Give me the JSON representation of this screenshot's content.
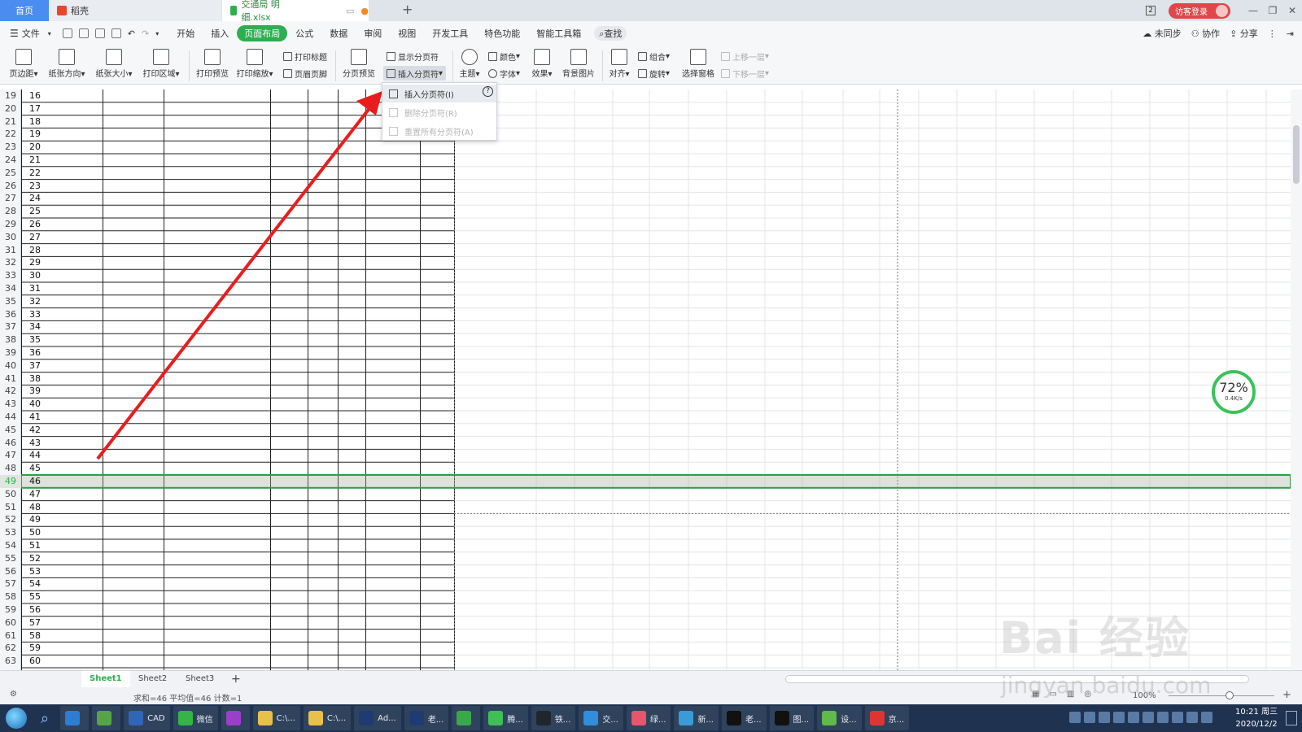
{
  "titlebar": {
    "home_tab": "首页",
    "daoke_tab": "稻壳",
    "file_tab": "交通局 明细.xlsx",
    "new_tab_glyph": "+",
    "badge": "2",
    "login": "访客登录"
  },
  "menubar": {
    "file_label": "文件",
    "tabs": [
      "开始",
      "插入",
      "页面布局",
      "公式",
      "数据",
      "审阅",
      "视图",
      "开发工具",
      "特色功能",
      "智能工具箱"
    ],
    "active_tab": "页面布局",
    "search_label": "查找",
    "right": {
      "sync": "未同步",
      "collab": "协作",
      "share": "分享"
    }
  },
  "ribbon": {
    "margins": "页边距",
    "orientation": "纸张方向",
    "size": "纸张大小",
    "print_area": "打印区域",
    "print_preview": "打印预览",
    "print_scale": "打印缩放",
    "print_titles": "打印标题",
    "header_footer": "页眉页脚",
    "page_break_preview": "分页预览",
    "show_page_breaks": "显示分页符",
    "insert_page_break": "插入分页符",
    "theme": "主题",
    "colors": "颜色",
    "fonts": "字体",
    "effects": "效果",
    "background": "背景图片",
    "align": "对齐",
    "group": "组合",
    "rotate": "旋转",
    "selection_pane": "选择窗格",
    "bring_forward": "上移一层",
    "send_backward": "下移一层"
  },
  "dropdown": {
    "insert": "插入分页符(I)",
    "delete": "删除分页符(R)",
    "reset": "重置所有分页符(A)",
    "help": "?"
  },
  "sheet": {
    "first_row": 19,
    "row_count": 45,
    "selected_row": 49,
    "value_offset": 3
  },
  "speed_widget": {
    "percent": "72%",
    "rate": "0.4K/s"
  },
  "sheet_tabs": [
    "Sheet1",
    "Sheet2",
    "Sheet3"
  ],
  "active_sheet": "Sheet1",
  "statusbar": {
    "summary": "求和=46  平均值=46  计数=1",
    "zoom": "100%"
  },
  "taskbar": {
    "items": [
      {
        "label": "",
        "color": "#2d7dd2"
      },
      {
        "label": "",
        "color": "#56a447"
      },
      {
        "label": "CAD",
        "color": "#2f66b8"
      },
      {
        "label": "微信",
        "color": "#35b449"
      },
      {
        "label": "",
        "color": "#9b3fc9"
      },
      {
        "label": "C:\\...",
        "color": "#e8c04a"
      },
      {
        "label": "C:\\...",
        "color": "#e8c04a"
      },
      {
        "label": "Ad...",
        "color": "#1f3b73"
      },
      {
        "label": "老...",
        "color": "#1f3b73"
      },
      {
        "label": "",
        "color": "#39a84b"
      },
      {
        "label": "腾...",
        "color": "#3fbf56"
      },
      {
        "label": "铁...",
        "color": "#20262e"
      },
      {
        "label": "交...",
        "color": "#2f8fdd"
      },
      {
        "label": "绿...",
        "color": "#e7566d"
      },
      {
        "label": "新...",
        "color": "#3a9bd8"
      },
      {
        "label": "老...",
        "color": "#111111"
      },
      {
        "label": "图...",
        "color": "#111111"
      },
      {
        "label": "设...",
        "color": "#61b84b"
      },
      {
        "label": "京...",
        "color": "#e03434"
      }
    ],
    "time": "10:21 周三",
    "date": "2020/12/2"
  },
  "watermark": {
    "brand": "Bai 经验",
    "url": "jingyan.baidu.com"
  },
  "colors": {
    "accent": "#2eae50",
    "home_tab": "#4a8cf0",
    "arrow": "#e81e1e",
    "selected_row": "#2ea043"
  }
}
